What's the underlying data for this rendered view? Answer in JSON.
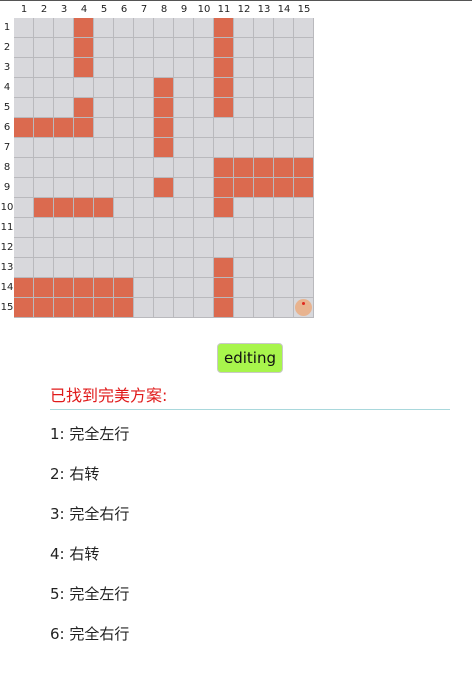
{
  "grid": {
    "columns": [
      "1",
      "2",
      "3",
      "4",
      "5",
      "6",
      "7",
      "8",
      "9",
      "10",
      "11",
      "12",
      "13",
      "14",
      "15"
    ],
    "rows": [
      "1",
      "2",
      "3",
      "4",
      "5",
      "6",
      "7",
      "8",
      "9",
      "10",
      "11",
      "12",
      "13",
      "14",
      "15"
    ],
    "walls": [
      [
        1,
        4
      ],
      [
        2,
        4
      ],
      [
        3,
        4
      ],
      [
        5,
        4
      ],
      [
        6,
        1
      ],
      [
        6,
        2
      ],
      [
        6,
        3
      ],
      [
        6,
        4
      ],
      [
        10,
        2
      ],
      [
        10,
        3
      ],
      [
        10,
        4
      ],
      [
        10,
        5
      ],
      [
        14,
        1
      ],
      [
        14,
        2
      ],
      [
        14,
        3
      ],
      [
        14,
        4
      ],
      [
        14,
        5
      ],
      [
        14,
        6
      ],
      [
        15,
        1
      ],
      [
        15,
        2
      ],
      [
        15,
        3
      ],
      [
        15,
        4
      ],
      [
        15,
        5
      ],
      [
        15,
        6
      ],
      [
        4,
        8
      ],
      [
        5,
        8
      ],
      [
        6,
        8
      ],
      [
        7,
        8
      ],
      [
        9,
        8
      ],
      [
        1,
        11
      ],
      [
        2,
        11
      ],
      [
        3,
        11
      ],
      [
        4,
        11
      ],
      [
        5,
        11
      ],
      [
        8,
        11
      ],
      [
        8,
        12
      ],
      [
        8,
        13
      ],
      [
        8,
        14
      ],
      [
        8,
        15
      ],
      [
        9,
        11
      ],
      [
        9,
        12
      ],
      [
        9,
        13
      ],
      [
        9,
        14
      ],
      [
        9,
        15
      ],
      [
        10,
        11
      ],
      [
        13,
        11
      ],
      [
        14,
        11
      ],
      [
        15,
        11
      ]
    ],
    "marker": [
      15,
      15
    ],
    "wall_color": "#db6a4f",
    "empty_color": "#d8d8dc",
    "marker_color": "#e8b38f"
  },
  "edit_button": {
    "label": "editing",
    "color": "#a8f54c"
  },
  "result": {
    "title": "已找到完美方案:",
    "title_color": "#e01a1a",
    "steps": [
      "1: 完全左行",
      "2: 右转",
      "3: 完全右行",
      "4: 右转",
      "5: 完全左行",
      "6: 完全右行"
    ]
  }
}
